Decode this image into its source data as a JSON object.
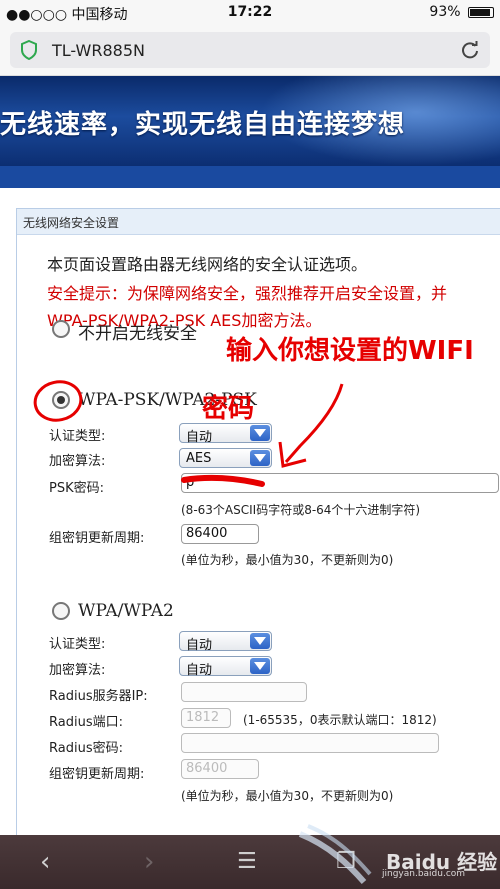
{
  "status_bar": {
    "carrier": "●●○○○ 中国移动",
    "time": "17:22",
    "battery": "93%",
    "battery_level": 0.93
  },
  "browser": {
    "url_title": "TL-WR885N"
  },
  "banner": {
    "slogan": "无线速率，实现无线自由连接梦想"
  },
  "panel": {
    "header": "无线网络安全设置",
    "description": "本页面设置路由器无线网络的安全认证选项。",
    "warning_line1": "安全提示：为保障网络安全，强烈推荐开启安全设置，并",
    "warning_line2": "WPA-PSK/WPA2-PSK AES加密方法。",
    "options": {
      "disable": {
        "label": "不开启无线安全",
        "checked": false
      },
      "wpa_psk": {
        "label": "WPA-PSK/WPA2-PSK",
        "checked": true,
        "auth_type_label": "认证类型:",
        "auth_type_value": "自动",
        "encryption_label": "加密算法:",
        "encryption_value": "AES",
        "psk_label": "PSK密码:",
        "psk_value": "p",
        "psk_hint": "(8-63个ASCII码字符或8-64个十六进制字符)",
        "group_key_label": "组密钥更新周期:",
        "group_key_value": "86400",
        "group_key_hint": "(单位为秒，最小值为30，不更新则为0)"
      },
      "wpa": {
        "label": "WPA/WPA2",
        "checked": false,
        "auth_type_label": "认证类型:",
        "auth_type_value": "自动",
        "encryption_label": "加密算法:",
        "encryption_value": "自动",
        "radius_ip_label": "Radius服务器IP:",
        "radius_ip_value": "",
        "radius_port_label": "Radius端口:",
        "radius_port_value": "1812",
        "radius_port_hint": "(1-65535，0表示默认端口：1812)",
        "radius_pwd_label": "Radius密码:",
        "radius_pwd_value": "",
        "group_key_label": "组密钥更新周期:",
        "group_key_value": "86400",
        "group_key_hint": "(单位为秒，最小值为30，不更新则为0)"
      }
    }
  },
  "annotation": {
    "line1": "输入你想设置的WIFI",
    "line2": "密码",
    "color": "#e60000"
  },
  "bottom_bar": {
    "back": "‹",
    "forward": "›",
    "menu": "☰",
    "tabs": "❐"
  },
  "watermark": {
    "brand": "Baidu 经验",
    "sub": "jingyan.baidu.com"
  }
}
